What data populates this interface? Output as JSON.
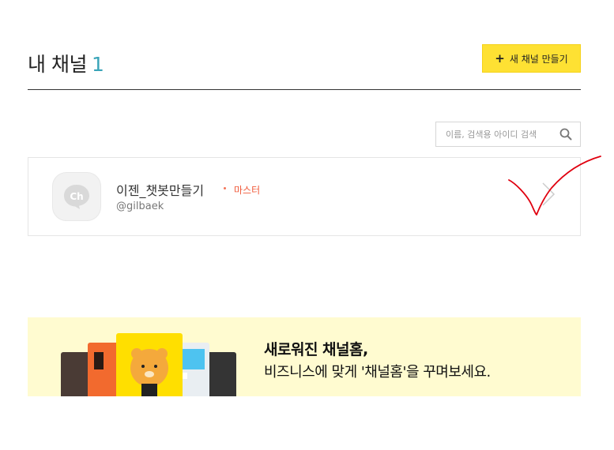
{
  "header": {
    "title": "내 채널",
    "count": "1",
    "new_button_label": "새 채널 만들기",
    "new_button_icon": "plus-icon"
  },
  "search": {
    "placeholder": "이름, 검색용 아이디 검색",
    "value": "",
    "icon": "search-icon"
  },
  "channel": {
    "name": "이젠_챗봇만들기",
    "role": "마스터",
    "id": "@gilbaek",
    "avatar_text": "Ch",
    "role_color": "#f05a3a"
  },
  "banner": {
    "title": "새로워진 채널홈,",
    "subtitle": "비즈니스에 맞게 '채널홈'을 꾸며보세요.",
    "background": "#fffbd0"
  },
  "colors": {
    "accent_button": "#fee133",
    "count_color": "#39a4b8",
    "annotation": "#e0000f"
  }
}
